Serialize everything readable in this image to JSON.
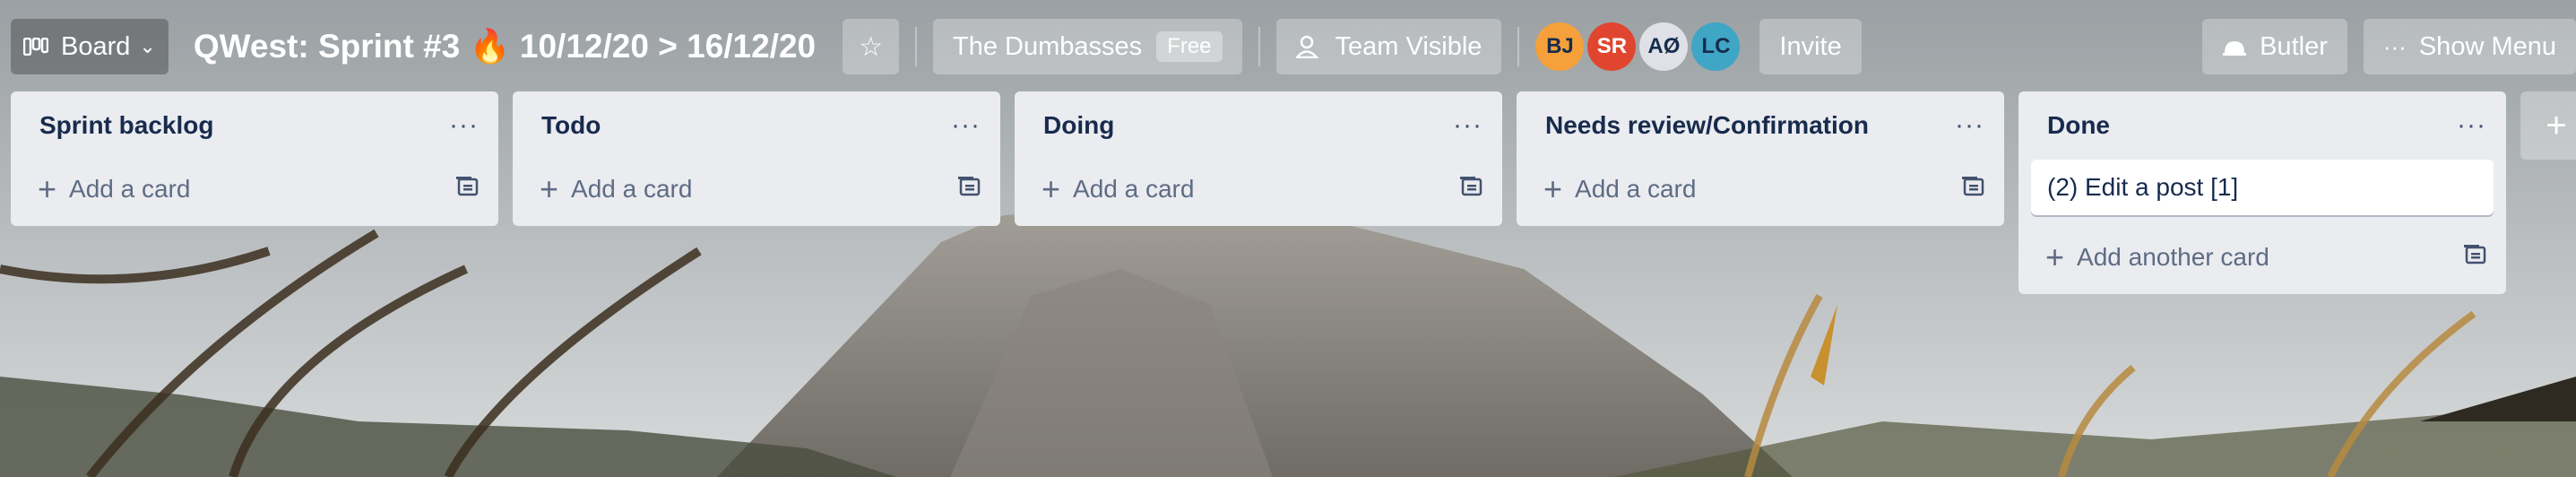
{
  "header": {
    "board_switcher_label": "Board",
    "board_title": "QWest: Sprint #3 🔥 10/12/20 > 16/12/20",
    "team_name": "The Dumbasses",
    "team_plan_badge": "Free",
    "visibility_label": "Team Visible",
    "members": [
      {
        "initials": "BJ",
        "color": "#f5a03b"
      },
      {
        "initials": "SR",
        "color": "#e0462f"
      },
      {
        "initials": "AØ",
        "color": "#dfe1e6"
      },
      {
        "initials": "LC",
        "color": "#3fa6c6"
      }
    ],
    "invite_label": "Invite",
    "butler_label": "Butler",
    "show_menu_label": "Show Menu"
  },
  "lists": [
    {
      "title": "Sprint backlog",
      "cards": [],
      "add_label": "Add a card"
    },
    {
      "title": "Todo",
      "cards": [],
      "add_label": "Add a card"
    },
    {
      "title": "Doing",
      "cards": [],
      "add_label": "Add a card"
    },
    {
      "title": "Needs review/Confirmation",
      "cards": [],
      "add_label": "Add a card"
    },
    {
      "title": "Done",
      "cards": [
        "(2) Edit a post [1]"
      ],
      "add_label": "Add another card"
    }
  ],
  "add_list_label": "+"
}
